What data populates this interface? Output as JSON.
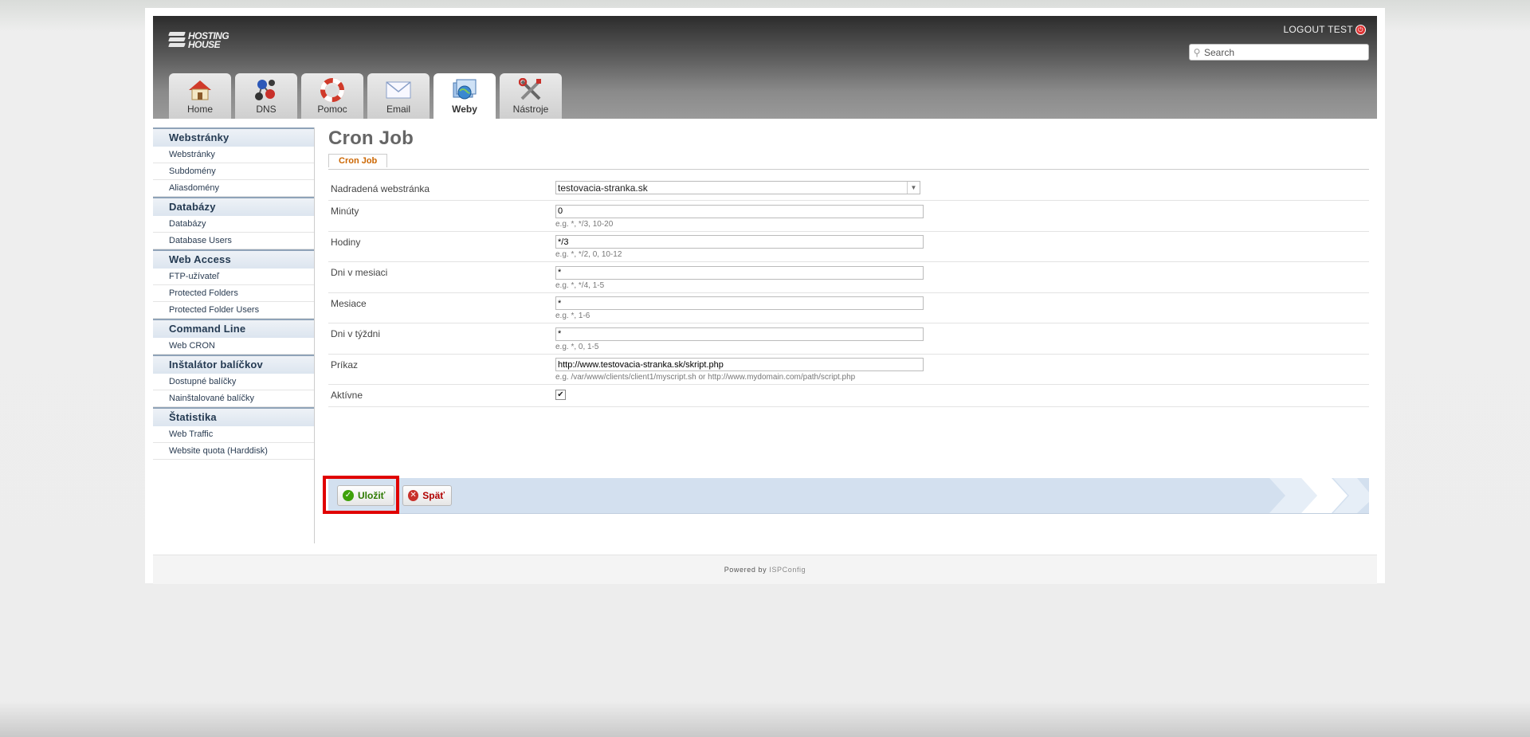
{
  "header": {
    "logo_text_1": "HOSTING",
    "logo_text_2": "HOUSE",
    "logout_label": "LOGOUT TEST",
    "search_placeholder": "Search"
  },
  "tabs": [
    {
      "label": "Home",
      "icon": "home-icon"
    },
    {
      "label": "DNS",
      "icon": "dns-icon"
    },
    {
      "label": "Pomoc",
      "icon": "help-lifebuoy-icon"
    },
    {
      "label": "Email",
      "icon": "email-icon"
    },
    {
      "label": "Weby",
      "icon": "websites-icon",
      "active": true
    },
    {
      "label": "Nástroje",
      "icon": "tools-icon"
    }
  ],
  "sidebar": {
    "sections": [
      {
        "title": "Webstránky",
        "items": [
          "Webstránky",
          "Subdomény",
          "Aliasdomény"
        ]
      },
      {
        "title": "Databázy",
        "items": [
          "Databázy",
          "Database Users"
        ]
      },
      {
        "title": "Web Access",
        "items": [
          "FTP-užívateľ",
          "Protected Folders",
          "Protected Folder Users"
        ]
      },
      {
        "title": "Command Line",
        "items": [
          "Web CRON"
        ]
      },
      {
        "title": "Inštalátor balíčkov",
        "items": [
          "Dostupné balíčky",
          "Nainštalované balíčky"
        ]
      },
      {
        "title": "Štatistika",
        "items": [
          "Web Traffic",
          "Website quota (Harddisk)"
        ]
      }
    ]
  },
  "main": {
    "title": "Cron Job",
    "subtab": "Cron Job",
    "form": {
      "parent_label": "Nadradená webstránka",
      "parent_value": "testovacia-stranka.sk",
      "minutes_label": "Minúty",
      "minutes_value": "0",
      "minutes_hint": "e.g. *, */3, 10-20",
      "hours_label": "Hodiny",
      "hours_value": "*/3",
      "hours_hint": "e.g. *, */2, 0, 10-12",
      "mday_label": "Dni v mesiaci",
      "mday_value": "*",
      "mday_hint": "e.g. *, */4, 1-5",
      "month_label": "Mesiace",
      "month_value": "*",
      "month_hint": "e.g. *, 1-6",
      "wday_label": "Dni v týždni",
      "wday_value": "*",
      "wday_hint": "e.g. *, 0, 1-5",
      "command_label": "Príkaz",
      "command_value": "http://www.testovacia-stranka.sk/skript.php",
      "command_hint": "e.g. /var/www/clients/client1/myscript.sh or http://www.mydomain.com/path/script.php",
      "active_label": "Aktívne",
      "active_checked": true
    },
    "buttons": {
      "save_label": "Uložiť",
      "back_label": "Späť"
    }
  },
  "footer": {
    "powered_by": "Powered by",
    "powered_link": "ISPConfig"
  },
  "colors": {
    "accent_orange": "#cc6600",
    "save_green": "#2d7a00",
    "back_red": "#b00000",
    "highlight_red": "#e00000",
    "action_bar": "#d3e0ef"
  }
}
